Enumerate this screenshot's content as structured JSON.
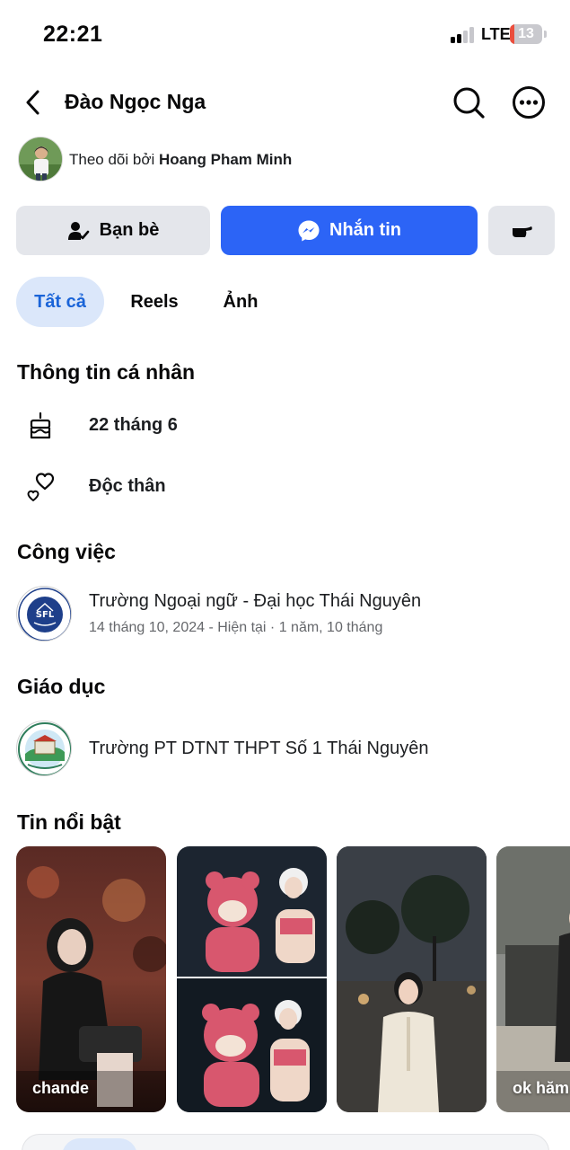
{
  "status_bar": {
    "time": "22:21",
    "network": "LTE",
    "battery": "13",
    "battery_level": 0.13
  },
  "header": {
    "title": "Đào Ngọc Nga"
  },
  "followed_by": {
    "prefix": "Theo dõi bởi",
    "name": "Hoang Pham Minh"
  },
  "actions": {
    "friends_label": "Bạn bè",
    "message_label": "Nhắn tin"
  },
  "tabs": [
    {
      "label": "Tất cả",
      "active": true
    },
    {
      "label": "Reels",
      "active": false
    },
    {
      "label": "Ảnh",
      "active": false
    }
  ],
  "personal_info": {
    "title": "Thông tin cá nhân",
    "birthday": "22 tháng 6",
    "relationship": "Độc thân"
  },
  "work": {
    "title": "Công việc",
    "name": "Trường Ngoại ngữ - Đại học Thái Nguyên",
    "detail": "14 tháng 10, 2024 - Hiện tại · 1 năm, 10 tháng"
  },
  "education": {
    "title": "Giáo dục",
    "name": "Trường PT DTNT THPT Số 1 Thái Nguyên"
  },
  "featured": {
    "title": "Tin nổi bật",
    "items": [
      {
        "caption": "chande"
      },
      {
        "caption": ""
      },
      {
        "caption": ""
      },
      {
        "caption": "ok hăm"
      }
    ]
  },
  "colors": {
    "primary_blue": "#2c64f6",
    "tab_active_bg": "#dbe7fa",
    "tab_active_text": "#1a64d8",
    "button_grey": "#e4e6eb",
    "battery_low": "#eb4e3d"
  }
}
